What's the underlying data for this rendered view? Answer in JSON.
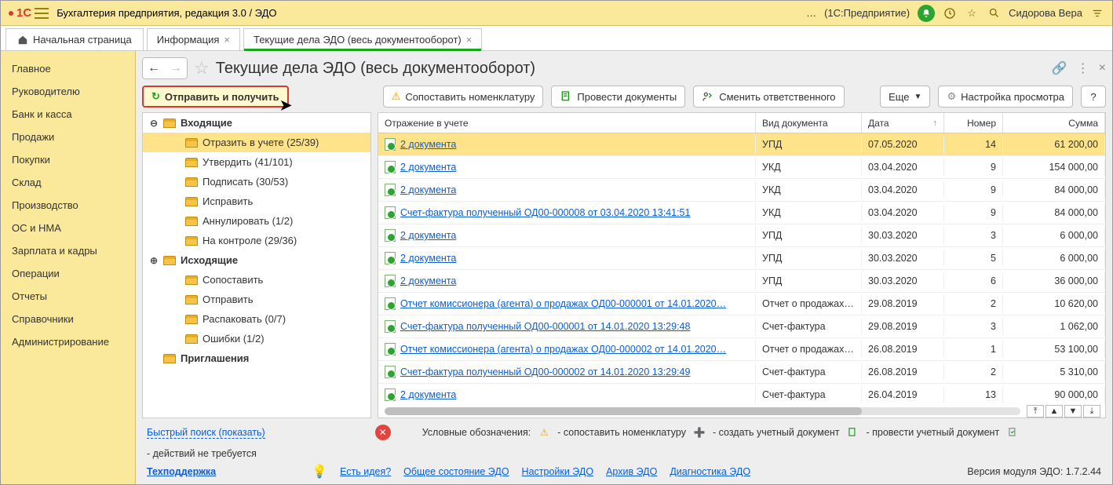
{
  "topbar": {
    "logo": "1С",
    "title_path": "Бухгалтерия предприятия, редакция 3.0 / ЭДО",
    "ellipsis": "…",
    "enterprise": "(1С:Предприятие)",
    "user": "Сидорова Вера"
  },
  "tabs": {
    "home": "Начальная страница",
    "items": [
      {
        "label": "Информация",
        "active": false
      },
      {
        "label": "Текущие дела ЭДО (весь документооборот)",
        "active": true
      }
    ],
    "close_glyph": "×"
  },
  "nav": [
    "Главное",
    "Руководителю",
    "Банк и касса",
    "Продажи",
    "Покупки",
    "Склад",
    "Производство",
    "ОС и НМА",
    "Зарплата и кадры",
    "Операции",
    "Отчеты",
    "Справочники",
    "Администрирование"
  ],
  "page": {
    "title": "Текущие дела ЭДО (весь документооборот)",
    "star_glyph": "☆",
    "back_glyph": "←",
    "forward_glyph": "→",
    "chain_glyph": "🔗",
    "more_glyph": "⋮",
    "close_glyph": "×"
  },
  "toolbar": {
    "send_receive": "Отправить и получить",
    "match_nomenclature": "Сопоставить номенклатуру",
    "post_docs": "Провести документы",
    "change_responsible": "Сменить ответственного",
    "more": "Еще",
    "settings_view": "Настройка просмотра",
    "help": "?"
  },
  "tree": [
    {
      "depth": 1,
      "toggle": "⊖",
      "label": "Входящие",
      "selected": false
    },
    {
      "depth": 2,
      "toggle": "",
      "label": "Отразить в учете (25/39)",
      "selected": true
    },
    {
      "depth": 2,
      "toggle": "",
      "label": "Утвердить (41/101)"
    },
    {
      "depth": 2,
      "toggle": "",
      "label": "Подписать (30/53)"
    },
    {
      "depth": 2,
      "toggle": "",
      "label": "Исправить"
    },
    {
      "depth": 2,
      "toggle": "",
      "label": "Аннулировать (1/2)"
    },
    {
      "depth": 2,
      "toggle": "",
      "label": "На контроле (29/36)"
    },
    {
      "depth": 1,
      "toggle": "⊕",
      "label": "Исходящие"
    },
    {
      "depth": 2,
      "toggle": "",
      "label": "Сопоставить"
    },
    {
      "depth": 2,
      "toggle": "",
      "label": "Отправить"
    },
    {
      "depth": 2,
      "toggle": "",
      "label": "Распаковать (0/7)"
    },
    {
      "depth": 2,
      "toggle": "",
      "label": "Ошибки (1/2)"
    },
    {
      "depth": 1,
      "toggle": "",
      "label": "Приглашения"
    }
  ],
  "table": {
    "columns": {
      "name": "Отражение в учете",
      "type": "Вид документа",
      "date": "Дата",
      "num": "Номер",
      "sum": "Сумма"
    },
    "rows": [
      {
        "name": "2 документа",
        "type": "УПД",
        "date": "07.05.2020",
        "num": "14",
        "sum": "61 200,00",
        "selected": true
      },
      {
        "name": "2 документа",
        "type": "УКД",
        "date": "03.04.2020",
        "num": "9",
        "sum": "154 000,00"
      },
      {
        "name": "2 документа",
        "type": "УКД",
        "date": "03.04.2020",
        "num": "9",
        "sum": "84 000,00"
      },
      {
        "name": "Счет-фактура полученный ОД00-000008 от 03.04.2020 13:41:51",
        "type": "УКД",
        "date": "03.04.2020",
        "num": "9",
        "sum": "84 000,00"
      },
      {
        "name": "2 документа",
        "type": "УПД",
        "date": "30.03.2020",
        "num": "3",
        "sum": "6 000,00"
      },
      {
        "name": "2 документа",
        "type": "УПД",
        "date": "30.03.2020",
        "num": "5",
        "sum": "6 000,00"
      },
      {
        "name": "2 документа",
        "type": "УПД",
        "date": "30.03.2020",
        "num": "6",
        "sum": "36 000,00"
      },
      {
        "name": "Отчет комиссионера (агента) о продажах ОД00-000001 от 14.01.2020…",
        "type": "Отчет о продажах…",
        "date": "29.08.2019",
        "num": "2",
        "sum": "10 620,00"
      },
      {
        "name": "Счет-фактура полученный ОД00-000001 от 14.01.2020 13:29:48",
        "type": "Счет-фактура",
        "date": "29.08.2019",
        "num": "3",
        "sum": "1 062,00"
      },
      {
        "name": "Отчет комиссионера (агента) о продажах ОД00-000002 от 14.01.2020…",
        "type": "Отчет о продажах…",
        "date": "26.08.2019",
        "num": "1",
        "sum": "53 100,00"
      },
      {
        "name": "Счет-фактура полученный ОД00-000002 от 14.01.2020 13:29:49",
        "type": "Счет-фактура",
        "date": "26.08.2019",
        "num": "2",
        "sum": "5 310,00"
      },
      {
        "name": "2 документа",
        "type": "Счет-фактура",
        "date": "26.04.2019",
        "num": "13",
        "sum": "90 000,00"
      }
    ]
  },
  "bottom": {
    "quick_search": "Быстрый поиск (показать)",
    "support": "Техподдержка",
    "idea": "Есть идея?",
    "legend_label": "Условные обозначения:",
    "legend_match": "- сопоставить номенклатуру",
    "legend_create": "- создать учетный документ",
    "legend_post": "- провести учетный документ",
    "legend_none": "- действий не требуется",
    "link_overall": "Общее состояние ЭДО",
    "link_settings": "Настройки ЭДО",
    "link_archive": "Архив ЭДО",
    "link_diag": "Диагностика ЭДО",
    "version": "Версия модуля ЭДО: 1.7.2.44"
  }
}
